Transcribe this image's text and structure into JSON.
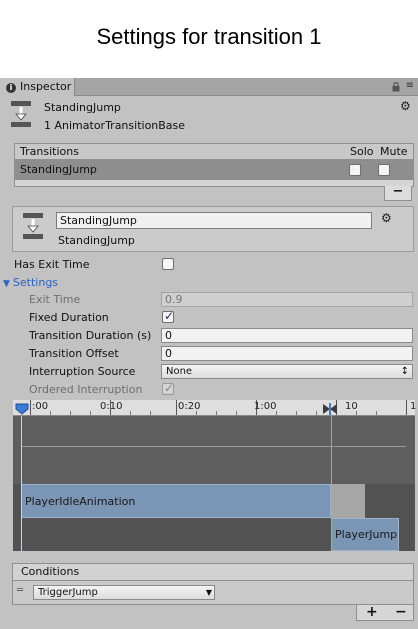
{
  "caption": "Settings for transition 1",
  "tab": {
    "title": "Inspector"
  },
  "header": {
    "name": "StandingJump",
    "type": "1 AnimatorTransitionBase"
  },
  "transitions": {
    "header": "Transitions",
    "solo_label": "Solo",
    "mute_label": "Mute",
    "rows": [
      {
        "name": "StandingJump",
        "solo": false,
        "mute": false
      }
    ],
    "remove_label": "−"
  },
  "transition": {
    "name_value": "StandingJump",
    "subtitle": "StandingJump"
  },
  "has_exit_time": {
    "label": "Has Exit Time",
    "checked": false
  },
  "settings": {
    "foldout_label": "Settings",
    "exit_time": {
      "label": "Exit Time",
      "value": "0.9"
    },
    "fixed_duration": {
      "label": "Fixed Duration",
      "checked": true
    },
    "transition_duration": {
      "label": "Transition Duration (s)",
      "value": "0"
    },
    "transition_offset": {
      "label": "Transition Offset",
      "value": "0"
    },
    "interruption_source": {
      "label": "Interruption Source",
      "value": "None"
    },
    "ordered_interruption": {
      "label": "Ordered Interruption",
      "checked": true
    }
  },
  "timeline": {
    "ticks": [
      ":00",
      "0:10",
      "0:20",
      "1:00",
      "10",
      "1"
    ],
    "state_a": "PlayerIdleAnimation",
    "state_b": "PlayerJump"
  },
  "conditions": {
    "header": "Conditions",
    "items": [
      {
        "parameter": "TriggerJump"
      }
    ],
    "add_label": "+",
    "remove_label": "−"
  },
  "colors": {
    "accent": "#3a7bd5",
    "state_bar": "#7b95b5",
    "timeline_bg": "#525252"
  }
}
